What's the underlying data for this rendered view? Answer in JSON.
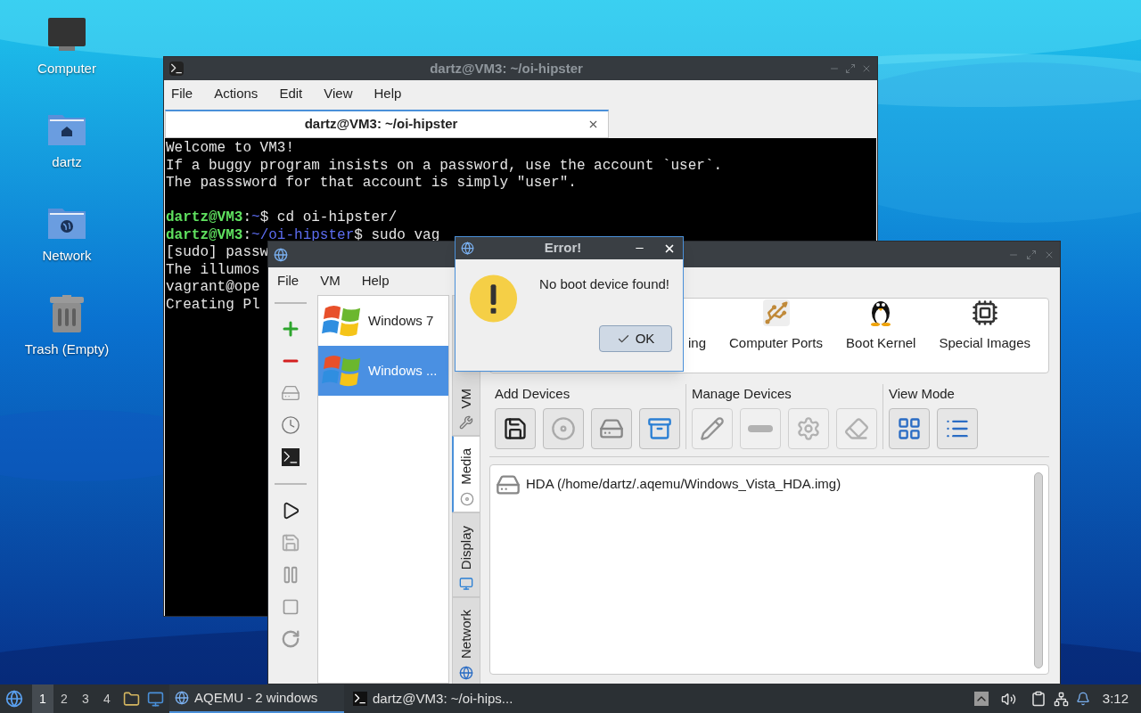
{
  "desktop_icons": [
    {
      "label": "Computer"
    },
    {
      "label": "dartz"
    },
    {
      "label": "Network"
    },
    {
      "label": "Trash (Empty)"
    }
  ],
  "terminal": {
    "title": "dartz@VM3: ~/oi-hipster",
    "menu": [
      "File",
      "Actions",
      "Edit",
      "View",
      "Help"
    ],
    "tabs": [
      {
        "label": "dartz@VM3: ~/oi-hipster",
        "selected": true
      }
    ],
    "lines": [
      {
        "kind": "text",
        "text": "Welcome to VM3!"
      },
      {
        "kind": "text",
        "text": "If a buggy program insists on a password, use the account `user`."
      },
      {
        "kind": "text",
        "text": "The passsword for that account is simply \"user\"."
      },
      {
        "kind": "blank"
      },
      {
        "kind": "prompt",
        "segments": [
          {
            "kind": "user",
            "text": "dartz@VM3"
          },
          {
            "kind": "plain",
            "text": ":"
          },
          {
            "kind": "path",
            "text": "~"
          },
          {
            "kind": "plain",
            "text": "$ cd oi-hipster/"
          }
        ]
      },
      {
        "kind": "prompt",
        "segments": [
          {
            "kind": "user",
            "text": "dartz@VM3"
          },
          {
            "kind": "plain",
            "text": ":"
          },
          {
            "kind": "path",
            "text": "~/oi-hipster"
          },
          {
            "kind": "plain",
            "text": "$ sudo vag"
          }
        ]
      },
      {
        "kind": "text",
        "text": "[sudo] passw"
      },
      {
        "kind": "text",
        "text": "The illumos"
      },
      {
        "kind": "text",
        "text": "vagrant@ope"
      },
      {
        "kind": "text",
        "text": "Creating Pl"
      }
    ]
  },
  "aqemu": {
    "menu": [
      "File",
      "VM",
      "Help"
    ],
    "vms": [
      {
        "name": "Windows 7",
        "selected": false
      },
      {
        "name": "Windows ...",
        "selected": true
      }
    ],
    "side_tabs": [
      {
        "label": "VM",
        "selected": false
      },
      {
        "label": "Media",
        "selected": true
      },
      {
        "label": "Display",
        "selected": false
      },
      {
        "label": "Network",
        "selected": false
      }
    ],
    "categories": [
      "ing",
      "Computer Ports",
      "Boot Kernel",
      "Special Images"
    ],
    "device_groups": [
      {
        "title": "Add Devices",
        "disabled": false
      },
      {
        "title": "Manage Devices",
        "disabled": true
      },
      {
        "title": "View Mode",
        "disabled": false
      }
    ],
    "devices": [
      {
        "label": "HDA (/home/dartz/.aqemu/Windows_Vista_HDA.img)"
      }
    ]
  },
  "dialog": {
    "title": "Error!",
    "message": "No boot device found!",
    "button": "OK"
  },
  "taskbar": {
    "workspaces": [
      {
        "label": "1",
        "selected": true
      },
      {
        "label": "2",
        "selected": false
      },
      {
        "label": "3",
        "selected": false
      },
      {
        "label": "4",
        "selected": false
      }
    ],
    "tasks": [
      {
        "label": "AQEMU - 2 windows",
        "selected": true
      },
      {
        "label": "dartz@VM3: ~/oi-hips...",
        "selected": false
      }
    ],
    "clock": "3:12"
  }
}
